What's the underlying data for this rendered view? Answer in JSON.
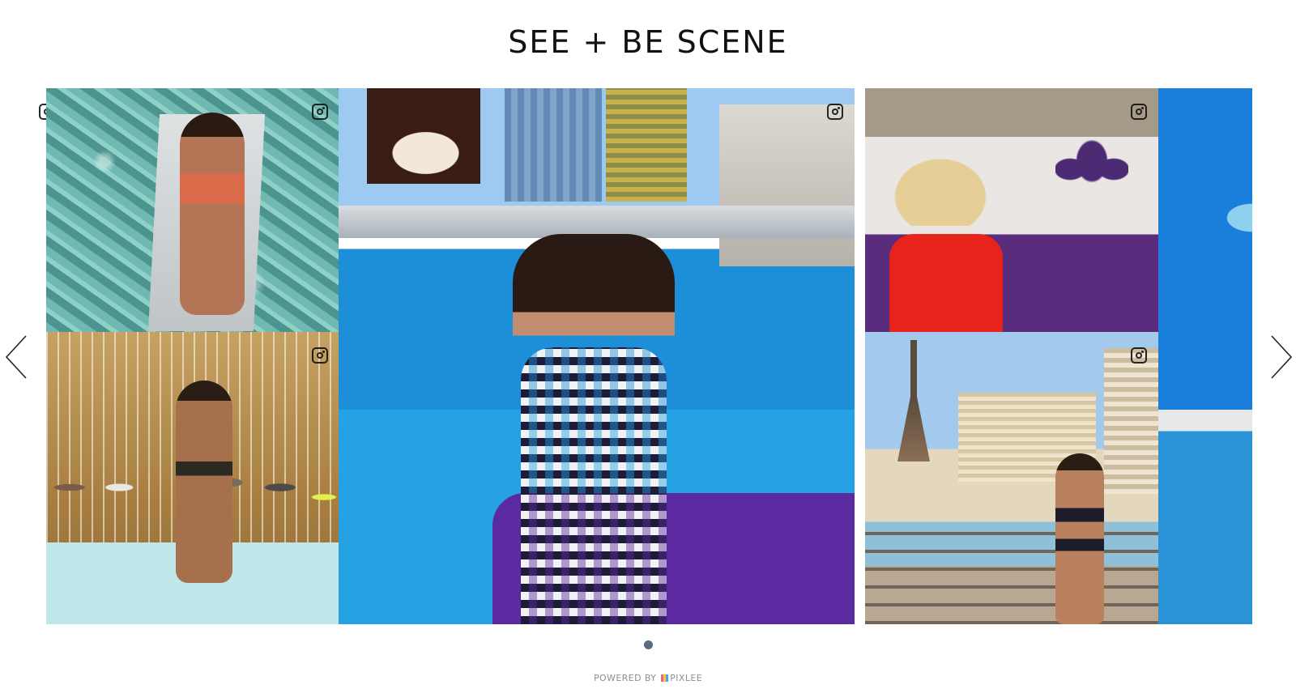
{
  "section": {
    "title": "SEE + BE SCENE"
  },
  "gallery": {
    "tiles": [
      {
        "name": "photo-pool-lounger",
        "source_icon": "instagram-icon"
      },
      {
        "name": "photo-waterfall",
        "source_icon": "instagram-icon"
      },
      {
        "name": "photo-main-pool",
        "source_icon": "instagram-icon"
      },
      {
        "name": "photo-hat-lounge",
        "source_icon": "instagram-icon"
      },
      {
        "name": "photo-eiffel-view",
        "source_icon": "instagram-icon"
      },
      {
        "name": "photo-partial-pool",
        "source_icon": "instagram-icon"
      }
    ],
    "pagination": {
      "current": 1,
      "total": 1
    },
    "prev_icon": "chevron-left-icon",
    "next_icon": "chevron-right-icon"
  },
  "footer": {
    "powered_by": "POWERED BY",
    "brand": "PIXLEE"
  },
  "colors": {
    "text": "#111111",
    "dot": "#5b6b7a",
    "footer_text": "#8a8f96",
    "pool_blue": "#24a2e3",
    "lounger_purple": "#5b2aa1"
  }
}
